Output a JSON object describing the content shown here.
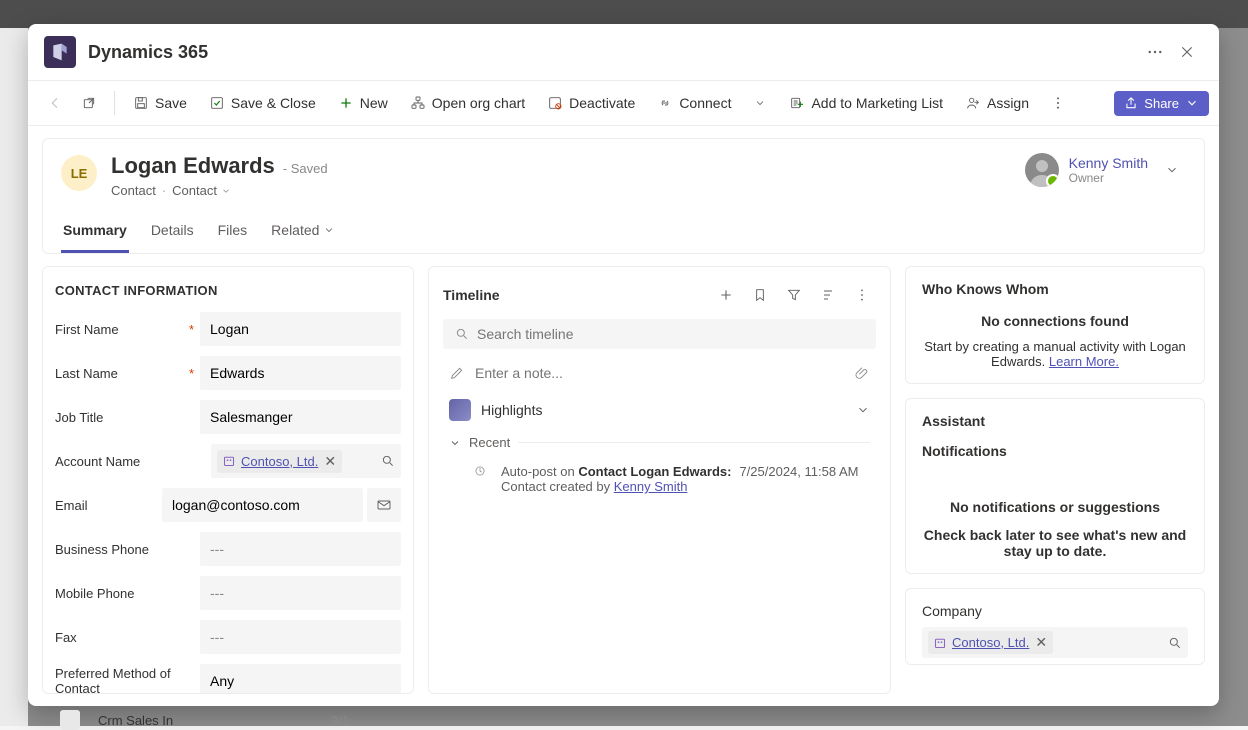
{
  "app": {
    "title": "Dynamics 365"
  },
  "cmdbar": {
    "save": "Save",
    "save_close": "Save & Close",
    "new": "New",
    "open_org_chart": "Open org chart",
    "deactivate": "Deactivate",
    "connect": "Connect",
    "add_marketing": "Add to Marketing List",
    "assign": "Assign",
    "share": "Share"
  },
  "record": {
    "avatar_initials": "LE",
    "name": "Logan Edwards",
    "saved_suffix": "- Saved",
    "entity": "Contact",
    "form": "Contact",
    "owner": {
      "name": "Kenny Smith",
      "label": "Owner"
    }
  },
  "tabs": {
    "summary": "Summary",
    "details": "Details",
    "files": "Files",
    "related": "Related"
  },
  "contact": {
    "section_title": "CONTACT INFORMATION",
    "labels": {
      "first_name": "First Name",
      "last_name": "Last Name",
      "job_title": "Job Title",
      "account_name": "Account Name",
      "email": "Email",
      "business_phone": "Business Phone",
      "mobile_phone": "Mobile Phone",
      "fax": "Fax",
      "preferred_method": "Preferred Method of Contact"
    },
    "values": {
      "first_name": "Logan",
      "last_name": "Edwards",
      "job_title": "Salesmanger",
      "account_name": "Contoso, Ltd.",
      "email": "logan@contoso.com",
      "business_phone": "---",
      "mobile_phone": "---",
      "fax": "---",
      "preferred_method": "Any"
    }
  },
  "timeline": {
    "title": "Timeline",
    "search_placeholder": "Search timeline",
    "note_placeholder": "Enter a note...",
    "highlights": "Highlights",
    "recent": "Recent",
    "item": {
      "prefix": "Auto-post on ",
      "subject": "Contact Logan Edwards:",
      "timestamp": "7/25/2024, 11:58 AM",
      "line2_pre": "Contact created by ",
      "line2_link": "Kenny Smith"
    }
  },
  "who": {
    "title": "Who Knows Whom",
    "empty_head": "No connections found",
    "empty_sub_pre": "Start by creating a manual activity with Logan Edwards. ",
    "learn_more": "Learn More."
  },
  "assistant": {
    "title": "Assistant"
  },
  "notifications": {
    "title": "Notifications",
    "empty_head": "No notifications or suggestions",
    "empty_sub": "Check back later to see what's new and stay up to date."
  },
  "company": {
    "title": "Company",
    "value": "Contoso, Ltd."
  },
  "backdrop": {
    "list_item": "Crm Sales In",
    "count": "3/1"
  }
}
